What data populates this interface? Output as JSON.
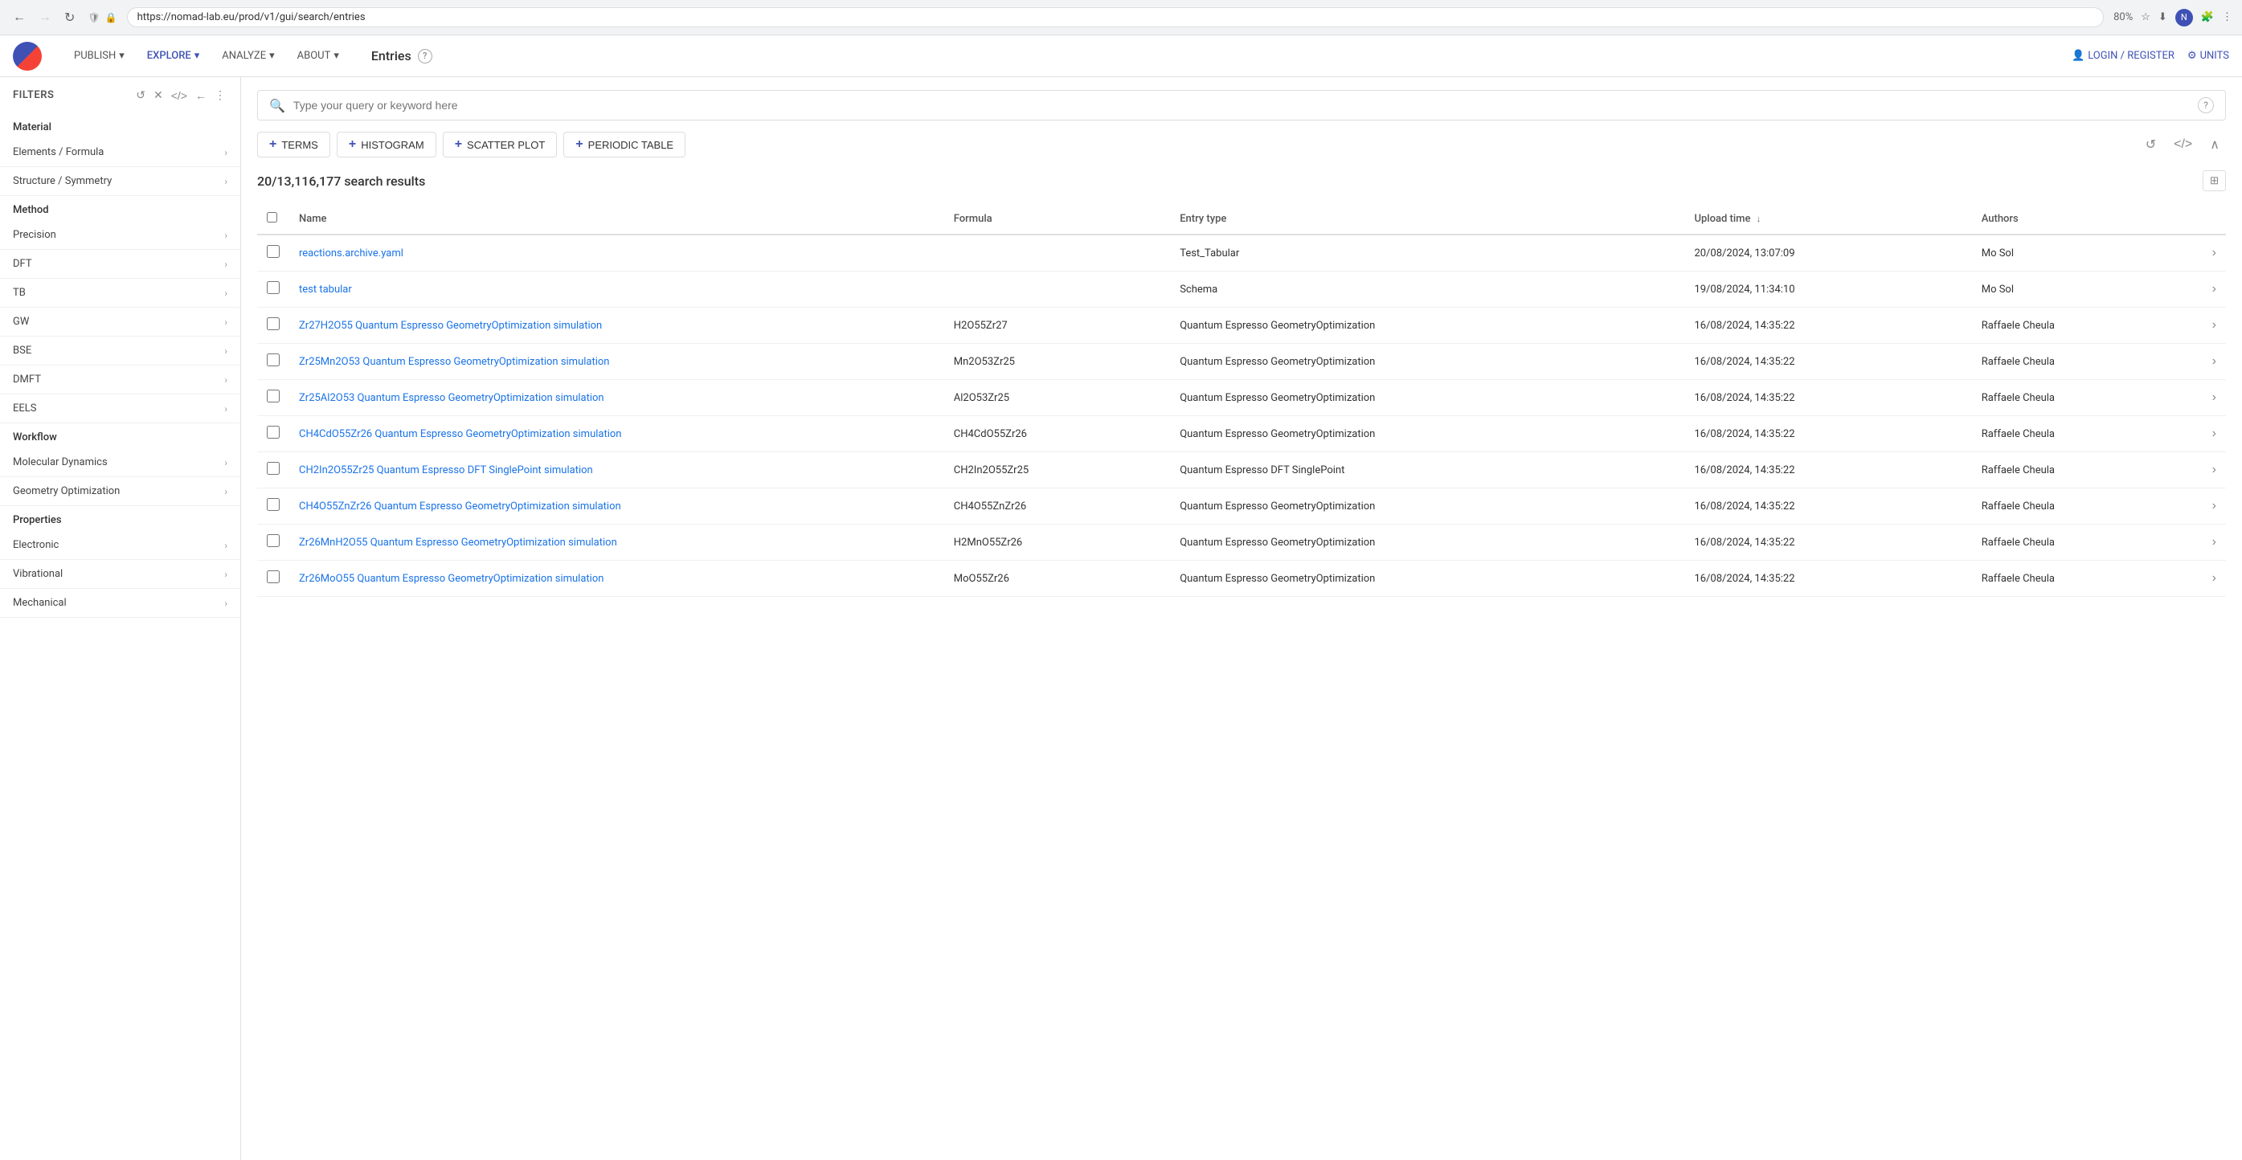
{
  "browser": {
    "url": "https://nomad-lab.eu/prod/v1/gui/search/entries",
    "zoom": "80%",
    "back_disabled": false,
    "forward_disabled": true
  },
  "nav": {
    "items": [
      {
        "id": "publish",
        "label": "PUBLISH",
        "active": false,
        "has_dropdown": true
      },
      {
        "id": "explore",
        "label": "EXPLORE",
        "active": true,
        "has_dropdown": true
      },
      {
        "id": "analyze",
        "label": "ANALYZE",
        "active": false,
        "has_dropdown": true
      },
      {
        "id": "about",
        "label": "ABOUT",
        "active": false,
        "has_dropdown": true
      }
    ],
    "login_label": "LOGIN / REGISTER",
    "units_label": "UNITS"
  },
  "page": {
    "title": "Entries",
    "help_tooltip": "Help"
  },
  "filters": {
    "header_label": "FILTERS",
    "reset_icon": "↺",
    "clear_icon": "✕",
    "code_icon": "</>",
    "back_icon": "←",
    "menu_icon": "⋮",
    "section_material": "Material",
    "items": [
      {
        "id": "elements-formula",
        "label": "Elements / Formula"
      },
      {
        "id": "structure-symmetry",
        "label": "Structure / Symmetry"
      }
    ],
    "section_method": "Method",
    "method_items": [
      {
        "id": "precision",
        "label": "Precision"
      },
      {
        "id": "dft",
        "label": "DFT"
      },
      {
        "id": "tb",
        "label": "TB"
      },
      {
        "id": "gw",
        "label": "GW"
      },
      {
        "id": "bse",
        "label": "BSE"
      },
      {
        "id": "dmft",
        "label": "DMFT"
      },
      {
        "id": "eels",
        "label": "EELS"
      }
    ],
    "section_workflow": "Workflow",
    "workflow_items": [
      {
        "id": "molecular-dynamics",
        "label": "Molecular Dynamics"
      },
      {
        "id": "geometry-optimization",
        "label": "Geometry Optimization"
      }
    ],
    "section_properties": "Properties",
    "properties_items": [
      {
        "id": "electronic",
        "label": "Electronic"
      },
      {
        "id": "vibrational",
        "label": "Vibrational"
      },
      {
        "id": "mechanical",
        "label": "Mechanical"
      }
    ]
  },
  "search": {
    "placeholder": "Type your query or keyword here"
  },
  "toolbar": {
    "terms_label": "TERMS",
    "histogram_label": "HISTOGRAM",
    "scatter_label": "SCATTER PLOT",
    "periodic_label": "PERIODIC TABLE"
  },
  "results": {
    "count_text": "20/13,116,177 search results",
    "columns": [
      {
        "id": "name",
        "label": "Name"
      },
      {
        "id": "formula",
        "label": "Formula"
      },
      {
        "id": "entry-type",
        "label": "Entry type"
      },
      {
        "id": "upload-time",
        "label": "Upload time",
        "sortable": true,
        "sort_dir": "desc"
      },
      {
        "id": "authors",
        "label": "Authors"
      }
    ],
    "rows": [
      {
        "name": "reactions.archive.yaml",
        "formula": "",
        "entry_type": "Test_Tabular",
        "upload_time": "20/08/2024, 13:07:09",
        "authors": "Mo Sol"
      },
      {
        "name": "test tabular",
        "formula": "",
        "entry_type": "Schema",
        "upload_time": "19/08/2024, 11:34:10",
        "authors": "Mo Sol"
      },
      {
        "name": "Zr27H2O55 Quantum Espresso GeometryOptimization simulation",
        "formula": "H2O55Zr27",
        "entry_type": "Quantum Espresso GeometryOptimization",
        "upload_time": "16/08/2024, 14:35:22",
        "authors": "Raffaele Cheula"
      },
      {
        "name": "Zr25Mn2O53 Quantum Espresso GeometryOptimization simulation",
        "formula": "Mn2O53Zr25",
        "entry_type": "Quantum Espresso GeometryOptimization",
        "upload_time": "16/08/2024, 14:35:22",
        "authors": "Raffaele Cheula"
      },
      {
        "name": "Zr25Al2O53 Quantum Espresso GeometryOptimization simulation",
        "formula": "Al2O53Zr25",
        "entry_type": "Quantum Espresso GeometryOptimization",
        "upload_time": "16/08/2024, 14:35:22",
        "authors": "Raffaele Cheula"
      },
      {
        "name": "CH4CdO55Zr26 Quantum Espresso GeometryOptimization simulation",
        "formula": "CH4CdO55Zr26",
        "entry_type": "Quantum Espresso GeometryOptimization",
        "upload_time": "16/08/2024, 14:35:22",
        "authors": "Raffaele Cheula"
      },
      {
        "name": "CH2In2O55Zr25 Quantum Espresso DFT SinglePoint simulation",
        "formula": "CH2In2O55Zr25",
        "entry_type": "Quantum Espresso DFT SinglePoint",
        "upload_time": "16/08/2024, 14:35:22",
        "authors": "Raffaele Cheula"
      },
      {
        "name": "CH4O55ZnZr26 Quantum Espresso GeometryOptimization simulation",
        "formula": "CH4O55ZnZr26",
        "entry_type": "Quantum Espresso GeometryOptimization",
        "upload_time": "16/08/2024, 14:35:22",
        "authors": "Raffaele Cheula"
      },
      {
        "name": "Zr26MnH2O55 Quantum Espresso GeometryOptimization simulation",
        "formula": "H2MnO55Zr26",
        "entry_type": "Quantum Espresso GeometryOptimization",
        "upload_time": "16/08/2024, 14:35:22",
        "authors": "Raffaele Cheula"
      },
      {
        "name": "Zr26MoO55 Quantum Espresso GeometryOptimization simulation",
        "formula": "MoO55Zr26",
        "entry_type": "Quantum Espresso GeometryOptimization",
        "upload_time": "16/08/2024, 14:35:22",
        "authors": "Raffaele Cheula"
      }
    ]
  }
}
